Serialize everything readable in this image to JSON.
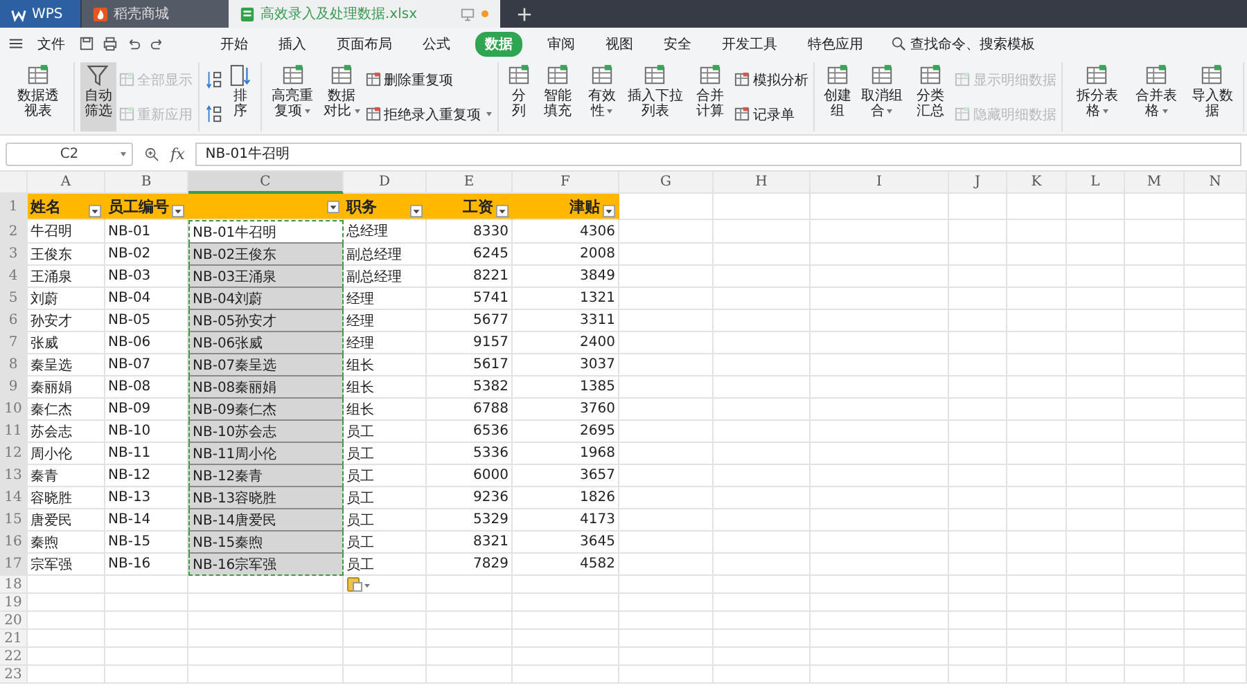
{
  "tabs": [
    {
      "label": "WPS",
      "kind": "app",
      "selected": false
    },
    {
      "label": "稻壳商城",
      "kind": "store",
      "selected": false
    },
    {
      "label": "高效录入及处理数据.xlsx",
      "kind": "doc",
      "selected": true
    }
  ],
  "menu": {
    "file": "文件",
    "items": [
      {
        "label": "开始",
        "selected": false
      },
      {
        "label": "插入",
        "selected": false
      },
      {
        "label": "页面布局",
        "selected": false
      },
      {
        "label": "公式",
        "selected": false
      },
      {
        "label": "数据",
        "selected": true
      },
      {
        "label": "审阅",
        "selected": false
      },
      {
        "label": "视图",
        "selected": false
      },
      {
        "label": "安全",
        "selected": false
      },
      {
        "label": "开发工具",
        "selected": false
      },
      {
        "label": "特色应用",
        "selected": false
      }
    ],
    "search": "查找命令、搜索模板"
  },
  "ribbon": [
    {
      "items": [
        {
          "kind": "big",
          "label": "数据透视表",
          "selected": false
        }
      ]
    },
    {
      "items": [
        {
          "kind": "filter",
          "label": "自动筛选",
          "selected": true
        },
        {
          "kind": "stack",
          "items": [
            {
              "label": "全部显示",
              "disabled": true
            },
            {
              "label": "重新应用",
              "disabled": true
            }
          ]
        }
      ]
    },
    {
      "items": [
        {
          "kind": "sort_icons"
        },
        {
          "kind": "sort",
          "label": "排序",
          "selected": false
        }
      ]
    },
    {
      "items": [
        {
          "kind": "big",
          "label": "高亮重复项",
          "dropdown": true,
          "selected": false
        },
        {
          "kind": "big",
          "label": "数据对比",
          "dropdown": true,
          "selected": false
        },
        {
          "kind": "stack",
          "items": [
            {
              "label": "删除重复项",
              "disabled": false
            },
            {
              "label": "拒绝录入重复项",
              "disabled": false,
              "dropdown": true
            }
          ]
        }
      ]
    },
    {
      "items": [
        {
          "kind": "big",
          "label": "分列",
          "selected": false
        },
        {
          "kind": "big",
          "label": "智能填充",
          "selected": false
        },
        {
          "kind": "big",
          "label": "有效性",
          "dropdown": true,
          "selected": false
        },
        {
          "kind": "big",
          "label": "插入下拉列表",
          "selected": false
        },
        {
          "kind": "big",
          "label": "合并计算",
          "selected": false
        },
        {
          "kind": "stack",
          "items": [
            {
              "label": "模拟分析",
              "disabled": false
            },
            {
              "label": "记录单",
              "disabled": false
            }
          ]
        }
      ]
    },
    {
      "items": [
        {
          "kind": "big",
          "label": "创建组",
          "selected": false
        },
        {
          "kind": "big",
          "label": "取消组合",
          "dropdown": true,
          "selected": false
        },
        {
          "kind": "big",
          "label": "分类汇总",
          "selected": false
        },
        {
          "kind": "stack",
          "items": [
            {
              "label": "显示明细数据",
              "disabled": true
            },
            {
              "label": "隐藏明细数据",
              "disabled": true
            }
          ]
        }
      ]
    },
    {
      "items": [
        {
          "kind": "big",
          "label": "拆分表格",
          "dropdown": true,
          "selected": false
        },
        {
          "kind": "big",
          "label": "合并表格",
          "dropdown": true,
          "selected": false
        },
        {
          "kind": "big",
          "label": "导入数据",
          "selected": false
        }
      ]
    }
  ],
  "formula_bar": {
    "cell": "C2",
    "fx": "fx",
    "value": "NB-01牛召明"
  },
  "columns": [
    {
      "label": "A",
      "selected": false
    },
    {
      "label": "B",
      "selected": false
    },
    {
      "label": "C",
      "selected": true
    },
    {
      "label": "D",
      "selected": false
    },
    {
      "label": "E",
      "selected": false
    },
    {
      "label": "F",
      "selected": false
    },
    {
      "label": "G",
      "selected": false
    },
    {
      "label": "H",
      "selected": false
    },
    {
      "label": "I",
      "selected": false
    },
    {
      "label": "J",
      "selected": false
    },
    {
      "label": "K",
      "selected": false
    },
    {
      "label": "L",
      "selected": false
    },
    {
      "label": "M",
      "selected": false
    },
    {
      "label": "N",
      "selected": false
    }
  ],
  "header": {
    "num": "1",
    "cells": [
      {
        "text": "姓名"
      },
      {
        "text": "员工编号"
      },
      {},
      {
        "text": "职务"
      },
      {
        "text": "工资"
      },
      {
        "text": "津贴"
      }
    ]
  },
  "rows": [
    {
      "num": "2",
      "cells": [
        "牛召明",
        "NB-01",
        "NB-01牛召明",
        "总经理",
        "8330",
        "4306"
      ],
      "selected": true,
      "active": true
    },
    {
      "num": "3",
      "cells": [
        "王俊东",
        "NB-02",
        "NB-02王俊东",
        "副总经理",
        "6245",
        "2008"
      ],
      "selected": true,
      "active": false
    },
    {
      "num": "4",
      "cells": [
        "王涌泉",
        "NB-03",
        "NB-03王涌泉",
        "副总经理",
        "8221",
        "3849"
      ],
      "selected": true,
      "active": false
    },
    {
      "num": "5",
      "cells": [
        "刘蔚",
        "NB-04",
        "NB-04刘蔚",
        "经理",
        "5741",
        "1321"
      ],
      "selected": true,
      "active": false
    },
    {
      "num": "6",
      "cells": [
        "孙安才",
        "NB-05",
        "NB-05孙安才",
        "经理",
        "5677",
        "3311"
      ],
      "selected": true,
      "active": false
    },
    {
      "num": "7",
      "cells": [
        "张威",
        "NB-06",
        "NB-06张威",
        "经理",
        "9157",
        "2400"
      ],
      "selected": true,
      "active": false
    },
    {
      "num": "8",
      "cells": [
        "秦呈选",
        "NB-07",
        "NB-07秦呈选",
        "组长",
        "5617",
        "3037"
      ],
      "selected": true,
      "active": false
    },
    {
      "num": "9",
      "cells": [
        "秦丽娟",
        "NB-08",
        "NB-08秦丽娟",
        "组长",
        "5382",
        "1385"
      ],
      "selected": true,
      "active": false
    },
    {
      "num": "10",
      "cells": [
        "秦仁杰",
        "NB-09",
        "NB-09秦仁杰",
        "组长",
        "6788",
        "3760"
      ],
      "selected": true,
      "active": false
    },
    {
      "num": "11",
      "cells": [
        "苏会志",
        "NB-10",
        "NB-10苏会志",
        "员工",
        "6536",
        "2695"
      ],
      "selected": true,
      "active": false
    },
    {
      "num": "12",
      "cells": [
        "周小伦",
        "NB-11",
        "NB-11周小伦",
        "员工",
        "5336",
        "1968"
      ],
      "selected": true,
      "active": false
    },
    {
      "num": "13",
      "cells": [
        "秦青",
        "NB-12",
        "NB-12秦青",
        "员工",
        "6000",
        "3657"
      ],
      "selected": true,
      "active": false
    },
    {
      "num": "14",
      "cells": [
        "容晓胜",
        "NB-13",
        "NB-13容晓胜",
        "员工",
        "9236",
        "1826"
      ],
      "selected": true,
      "active": false
    },
    {
      "num": "15",
      "cells": [
        "唐爱民",
        "NB-14",
        "NB-14唐爱民",
        "员工",
        "5329",
        "4173"
      ],
      "selected": true,
      "active": false
    },
    {
      "num": "16",
      "cells": [
        "秦煦",
        "NB-15",
        "NB-15秦煦",
        "员工",
        "8321",
        "3645"
      ],
      "selected": true,
      "active": false
    },
    {
      "num": "17",
      "cells": [
        "宗军强",
        "NB-16",
        "NB-16宗军强",
        "员工",
        "7829",
        "4582"
      ],
      "selected": true,
      "active": false
    },
    {
      "num": "18",
      "selected": false,
      "active": false,
      "paste_button": true
    },
    {
      "num": "19",
      "selected": false,
      "active": false
    },
    {
      "num": "20",
      "selected": false,
      "active": false
    },
    {
      "num": "21",
      "selected": false,
      "active": false
    },
    {
      "num": "22",
      "selected": false,
      "active": false
    },
    {
      "num": "23",
      "selected": false,
      "active": false
    }
  ]
}
